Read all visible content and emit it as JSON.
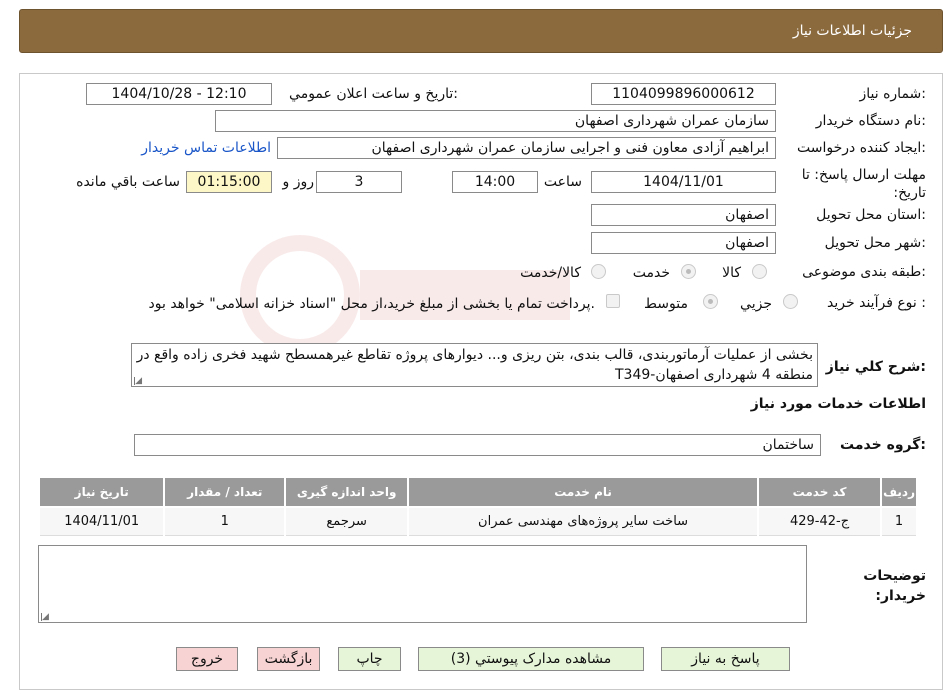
{
  "header": {
    "title": "جزئیات اطلاعات نیاز"
  },
  "form": {
    "need_number_label": "شماره نیاز:",
    "need_number": "1104099896000612",
    "announce_label": "تاریخ و ساعت اعلان عمومي:",
    "announce_value": "1404/10/28 - 12:10",
    "buyer_org_label": "نام دستگاه خريدار:",
    "buyer_org": "سازمان عمران شهرداری اصفهان",
    "requester_label": "ايجاد كننده درخواست:",
    "requester": "ابراهیم آزادی معاون فنی و اجرایی سازمان عمران شهرداری اصفهان",
    "contact_link": "اطلاعات تماس خريدار",
    "deadline_label": "مهلت ارسال پاسخ: تا تاريخ:",
    "deadline_date": "1404/11/01",
    "time_label": "ساعت",
    "deadline_time": "14:00",
    "days": "3",
    "days_label": "روز و",
    "remaining_time": "01:15:00",
    "remaining_label": "ساعت باقي مانده",
    "province_label": "استان محل تحويل:",
    "province": "اصفهان",
    "city_label": "شهر محل تحويل:",
    "city": "اصفهان",
    "category_label": "طبقه بندی موضوعی:",
    "category_options": [
      "كالا",
      "خدمت",
      "كالا/خدمت"
    ],
    "process_label": "نوع فرآیند خرید :",
    "process_options": [
      "جزيي",
      "متوسط"
    ],
    "payment_note": "پرداخت تمام یا بخشی از مبلغ خرید،از محل \"اسناد خزانه اسلامی\" خواهد بود.",
    "description_label": "شرح كلي نياز:",
    "description": "بخشی از عملیات آرماتوربندی، قالب بندی، بتن ریزی و... دیوارهای پروژه تقاطع غیرهمسطح شهید فخری زاده واقع در منطقه 4 شهرداری اصفهان-T349"
  },
  "services": {
    "section_title": "اطلاعات خدمات مورد نياز",
    "group_label": "گروه خدمت:",
    "group_value": "ساختمان",
    "columns": [
      "رديف",
      "كد خدمت",
      "نام خدمت",
      "واحد اندازه گيری",
      "تعداد / مقدار",
      "تاريخ نياز"
    ],
    "rows": [
      [
        "1",
        "ج-42-429",
        "ساخت سایر پروژه‌های مهندسی عمران",
        "سرجمع",
        "1",
        "1404/11/01"
      ]
    ]
  },
  "notes": {
    "label": "توضيحات خريدار:",
    "value": ""
  },
  "buttons": {
    "reply": "پاسخ به نياز",
    "attachments": "مشاهده مدارک پيوستي (3)",
    "print": "چاپ",
    "back": "بازگشت",
    "exit": "خروج"
  },
  "colors": {
    "header": "#8b6a3e",
    "table_header": "#9a9a9a",
    "link": "#1a56c8"
  }
}
